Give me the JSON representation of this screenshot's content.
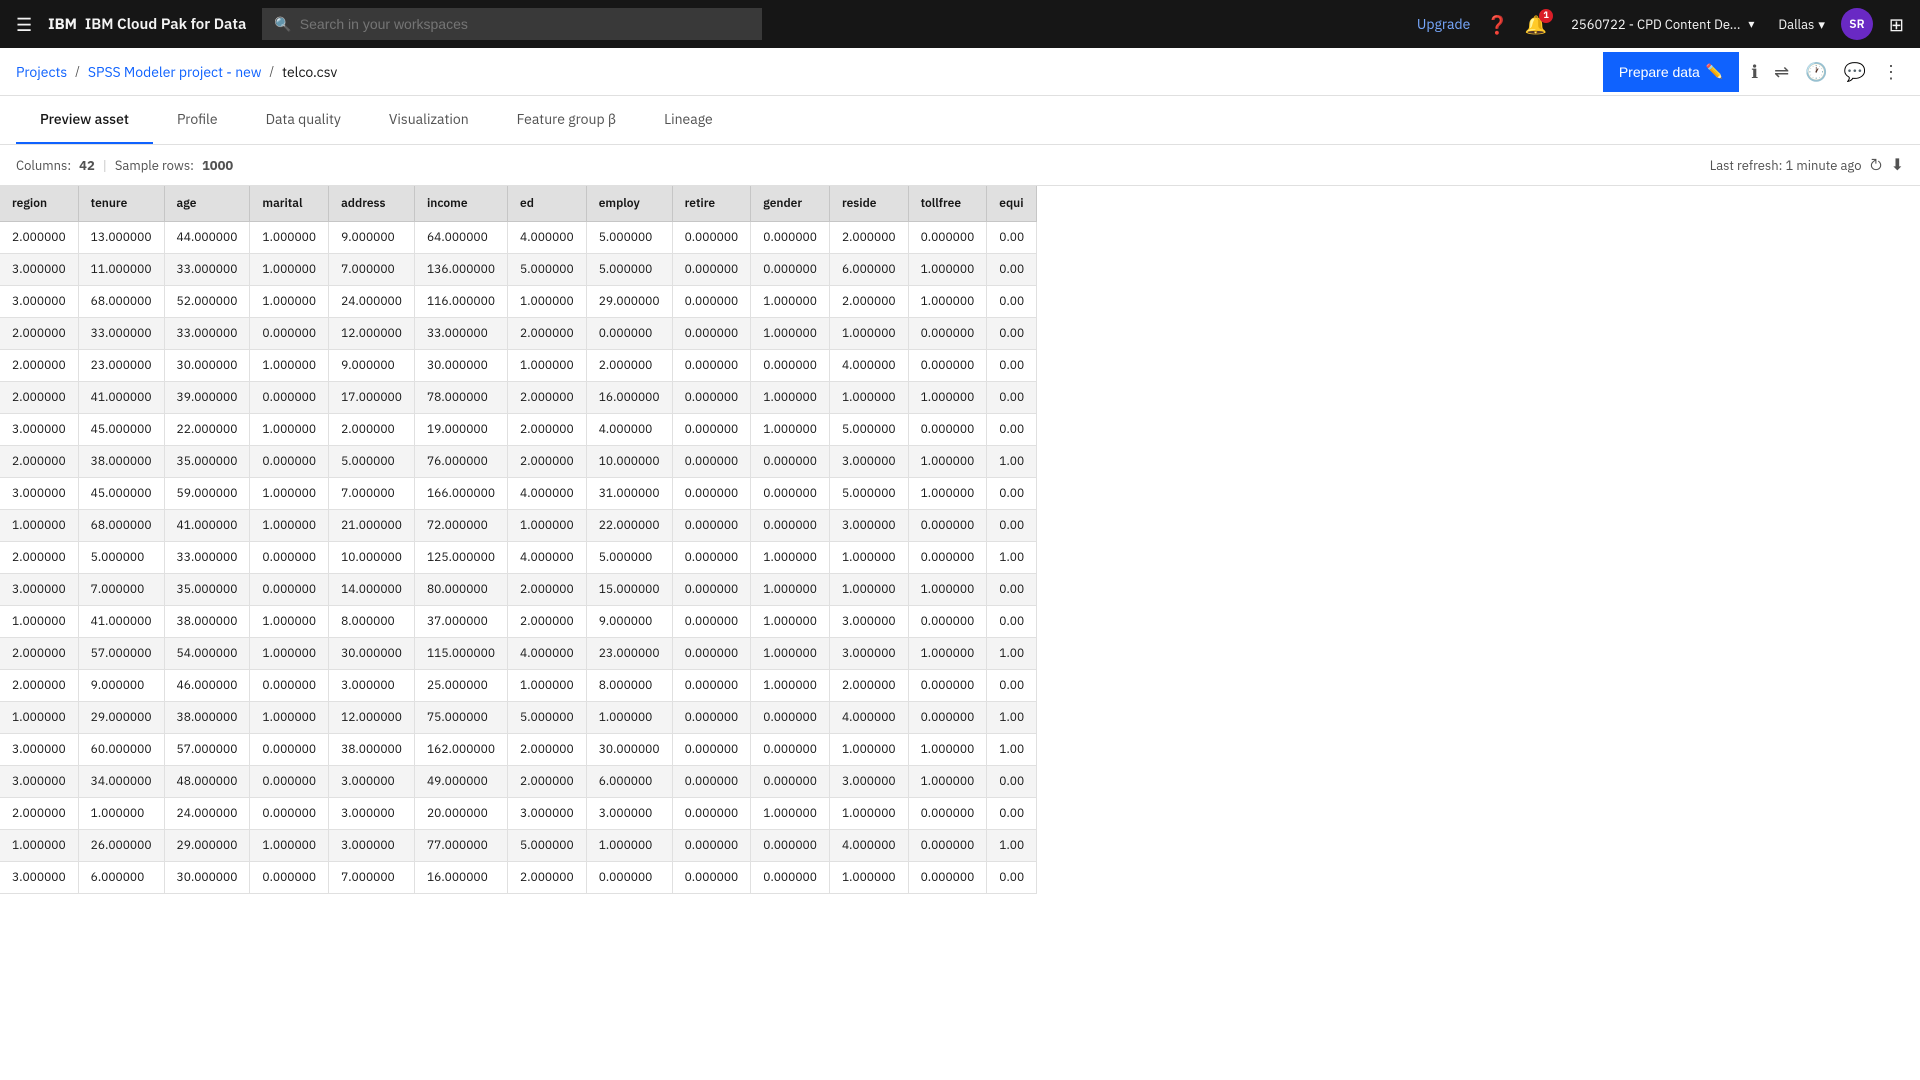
{
  "topnav": {
    "logo": "IBM Cloud Pak for Data",
    "search_placeholder": "Search in your workspaces",
    "upgrade_label": "Upgrade",
    "account_name": "2560722 - CPD Content De...",
    "location": "Dallas",
    "avatar_initials": "SR",
    "notification_count": "1"
  },
  "breadcrumb": {
    "items": [
      "Projects",
      "SPSS Modeler project - new"
    ],
    "current": "telco.csv",
    "prepare_label": "Prepare data"
  },
  "tabs": [
    {
      "id": "preview",
      "label": "Preview asset",
      "active": true
    },
    {
      "id": "profile",
      "label": "Profile",
      "active": false
    },
    {
      "id": "dataquality",
      "label": "Data quality",
      "active": false
    },
    {
      "id": "visualization",
      "label": "Visualization",
      "active": false
    },
    {
      "id": "featuregroup",
      "label": "Feature group β",
      "active": false
    },
    {
      "id": "lineage",
      "label": "Lineage",
      "active": false
    }
  ],
  "table_info": {
    "columns_label": "Columns:",
    "columns_value": "42",
    "sample_rows_label": "Sample rows:",
    "sample_rows_value": "1000",
    "last_refresh": "Last refresh: 1 minute ago"
  },
  "columns": [
    "region",
    "tenure",
    "age",
    "marital",
    "address",
    "income",
    "ed",
    "employ",
    "retire",
    "gender",
    "reside",
    "tollfree",
    "equi"
  ],
  "rows": [
    [
      "2.000000",
      "13.000000",
      "44.000000",
      "1.000000",
      "9.000000",
      "64.000000",
      "4.000000",
      "5.000000",
      "0.000000",
      "0.000000",
      "2.000000",
      "0.000000",
      "0.00"
    ],
    [
      "3.000000",
      "11.000000",
      "33.000000",
      "1.000000",
      "7.000000",
      "136.000000",
      "5.000000",
      "5.000000",
      "0.000000",
      "0.000000",
      "6.000000",
      "1.000000",
      "0.00"
    ],
    [
      "3.000000",
      "68.000000",
      "52.000000",
      "1.000000",
      "24.000000",
      "116.000000",
      "1.000000",
      "29.000000",
      "0.000000",
      "1.000000",
      "2.000000",
      "1.000000",
      "0.00"
    ],
    [
      "2.000000",
      "33.000000",
      "33.000000",
      "0.000000",
      "12.000000",
      "33.000000",
      "2.000000",
      "0.000000",
      "0.000000",
      "1.000000",
      "1.000000",
      "0.000000",
      "0.00"
    ],
    [
      "2.000000",
      "23.000000",
      "30.000000",
      "1.000000",
      "9.000000",
      "30.000000",
      "1.000000",
      "2.000000",
      "0.000000",
      "0.000000",
      "4.000000",
      "0.000000",
      "0.00"
    ],
    [
      "2.000000",
      "41.000000",
      "39.000000",
      "0.000000",
      "17.000000",
      "78.000000",
      "2.000000",
      "16.000000",
      "0.000000",
      "1.000000",
      "1.000000",
      "1.000000",
      "0.00"
    ],
    [
      "3.000000",
      "45.000000",
      "22.000000",
      "1.000000",
      "2.000000",
      "19.000000",
      "2.000000",
      "4.000000",
      "0.000000",
      "1.000000",
      "5.000000",
      "0.000000",
      "0.00"
    ],
    [
      "2.000000",
      "38.000000",
      "35.000000",
      "0.000000",
      "5.000000",
      "76.000000",
      "2.000000",
      "10.000000",
      "0.000000",
      "0.000000",
      "3.000000",
      "1.000000",
      "1.00"
    ],
    [
      "3.000000",
      "45.000000",
      "59.000000",
      "1.000000",
      "7.000000",
      "166.000000",
      "4.000000",
      "31.000000",
      "0.000000",
      "0.000000",
      "5.000000",
      "1.000000",
      "0.00"
    ],
    [
      "1.000000",
      "68.000000",
      "41.000000",
      "1.000000",
      "21.000000",
      "72.000000",
      "1.000000",
      "22.000000",
      "0.000000",
      "0.000000",
      "3.000000",
      "0.000000",
      "0.00"
    ],
    [
      "2.000000",
      "5.000000",
      "33.000000",
      "0.000000",
      "10.000000",
      "125.000000",
      "4.000000",
      "5.000000",
      "0.000000",
      "1.000000",
      "1.000000",
      "0.000000",
      "1.00"
    ],
    [
      "3.000000",
      "7.000000",
      "35.000000",
      "0.000000",
      "14.000000",
      "80.000000",
      "2.000000",
      "15.000000",
      "0.000000",
      "1.000000",
      "1.000000",
      "1.000000",
      "0.00"
    ],
    [
      "1.000000",
      "41.000000",
      "38.000000",
      "1.000000",
      "8.000000",
      "37.000000",
      "2.000000",
      "9.000000",
      "0.000000",
      "1.000000",
      "3.000000",
      "0.000000",
      "0.00"
    ],
    [
      "2.000000",
      "57.000000",
      "54.000000",
      "1.000000",
      "30.000000",
      "115.000000",
      "4.000000",
      "23.000000",
      "0.000000",
      "1.000000",
      "3.000000",
      "1.000000",
      "1.00"
    ],
    [
      "2.000000",
      "9.000000",
      "46.000000",
      "0.000000",
      "3.000000",
      "25.000000",
      "1.000000",
      "8.000000",
      "0.000000",
      "1.000000",
      "2.000000",
      "0.000000",
      "0.00"
    ],
    [
      "1.000000",
      "29.000000",
      "38.000000",
      "1.000000",
      "12.000000",
      "75.000000",
      "5.000000",
      "1.000000",
      "0.000000",
      "0.000000",
      "4.000000",
      "0.000000",
      "1.00"
    ],
    [
      "3.000000",
      "60.000000",
      "57.000000",
      "0.000000",
      "38.000000",
      "162.000000",
      "2.000000",
      "30.000000",
      "0.000000",
      "0.000000",
      "1.000000",
      "1.000000",
      "1.00"
    ],
    [
      "3.000000",
      "34.000000",
      "48.000000",
      "0.000000",
      "3.000000",
      "49.000000",
      "2.000000",
      "6.000000",
      "0.000000",
      "0.000000",
      "3.000000",
      "1.000000",
      "0.00"
    ],
    [
      "2.000000",
      "1.000000",
      "24.000000",
      "0.000000",
      "3.000000",
      "20.000000",
      "3.000000",
      "3.000000",
      "0.000000",
      "1.000000",
      "1.000000",
      "0.000000",
      "0.00"
    ],
    [
      "1.000000",
      "26.000000",
      "29.000000",
      "1.000000",
      "3.000000",
      "77.000000",
      "5.000000",
      "1.000000",
      "0.000000",
      "0.000000",
      "4.000000",
      "0.000000",
      "1.00"
    ],
    [
      "3.000000",
      "6.000000",
      "30.000000",
      "0.000000",
      "7.000000",
      "16.000000",
      "2.000000",
      "0.000000",
      "0.000000",
      "0.000000",
      "1.000000",
      "0.000000",
      "0.00"
    ]
  ]
}
